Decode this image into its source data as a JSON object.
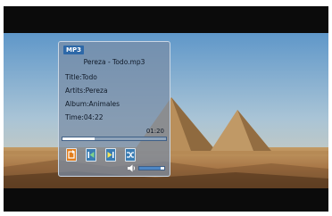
{
  "panel": {
    "tag": "MP3",
    "filename": "Pereza  -  Todo.mp3",
    "title_line": "Title:Todo",
    "artist_line": "Artits:Pereza",
    "album_line": "Album:Animales",
    "time_line": "Time:04:22",
    "elapsed": "01:20"
  },
  "playback": {
    "progress_fraction": 0.31
  },
  "volume": {
    "level_fraction": 0.85
  },
  "controls": [
    {
      "icon": "repeat-icon",
      "selected": true
    },
    {
      "icon": "previous-icon",
      "selected": false
    },
    {
      "icon": "next-icon",
      "selected": false
    },
    {
      "icon": "shuffle-icon",
      "selected": false
    }
  ],
  "colors": {
    "panel": "#7a8ca5",
    "tag": "#2d68a8",
    "selected_control": "#e27d1c",
    "control": "#3b7db3",
    "volume_fill": "#4d86c4"
  }
}
